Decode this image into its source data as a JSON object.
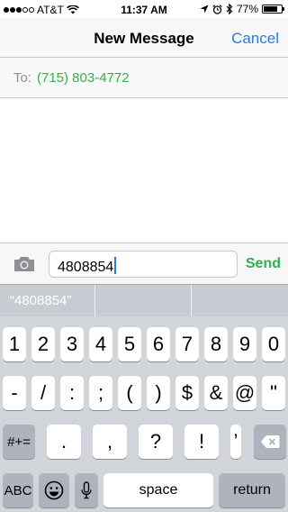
{
  "status_bar": {
    "carrier": "AT&T",
    "time": "11:37 AM",
    "battery": "77%",
    "battery_level": 0.77,
    "signal_bars_filled": 3,
    "signal_bars_total": 5,
    "icons": [
      "wifi-icon",
      "location-icon",
      "alarm-icon",
      "bluetooth-icon",
      "battery-icon"
    ]
  },
  "nav": {
    "title": "New Message",
    "cancel_label": "Cancel"
  },
  "recipient": {
    "label": "To:",
    "value": "(715) 803-4772"
  },
  "composer": {
    "text": "4808854",
    "send_label": "Send"
  },
  "suggestions": [
    "“4808854”",
    "",
    ""
  ],
  "keyboard": {
    "row1": [
      "1",
      "2",
      "3",
      "4",
      "5",
      "6",
      "7",
      "8",
      "9",
      "0"
    ],
    "row2": [
      "-",
      "/",
      ":",
      ";",
      "(",
      ")",
      "$",
      "&",
      "@",
      "\""
    ],
    "shift_label": "#+=",
    "row3": [
      ".",
      ",",
      "?",
      "!",
      "’"
    ],
    "abc_label": "ABC",
    "space_label": "space",
    "return_label": "return"
  },
  "colors": {
    "accent_blue": "#2a7ae2",
    "green": "#30b24e",
    "keyboard_bg": "#d1d4d9",
    "key_dark": "#aeb3bd"
  }
}
